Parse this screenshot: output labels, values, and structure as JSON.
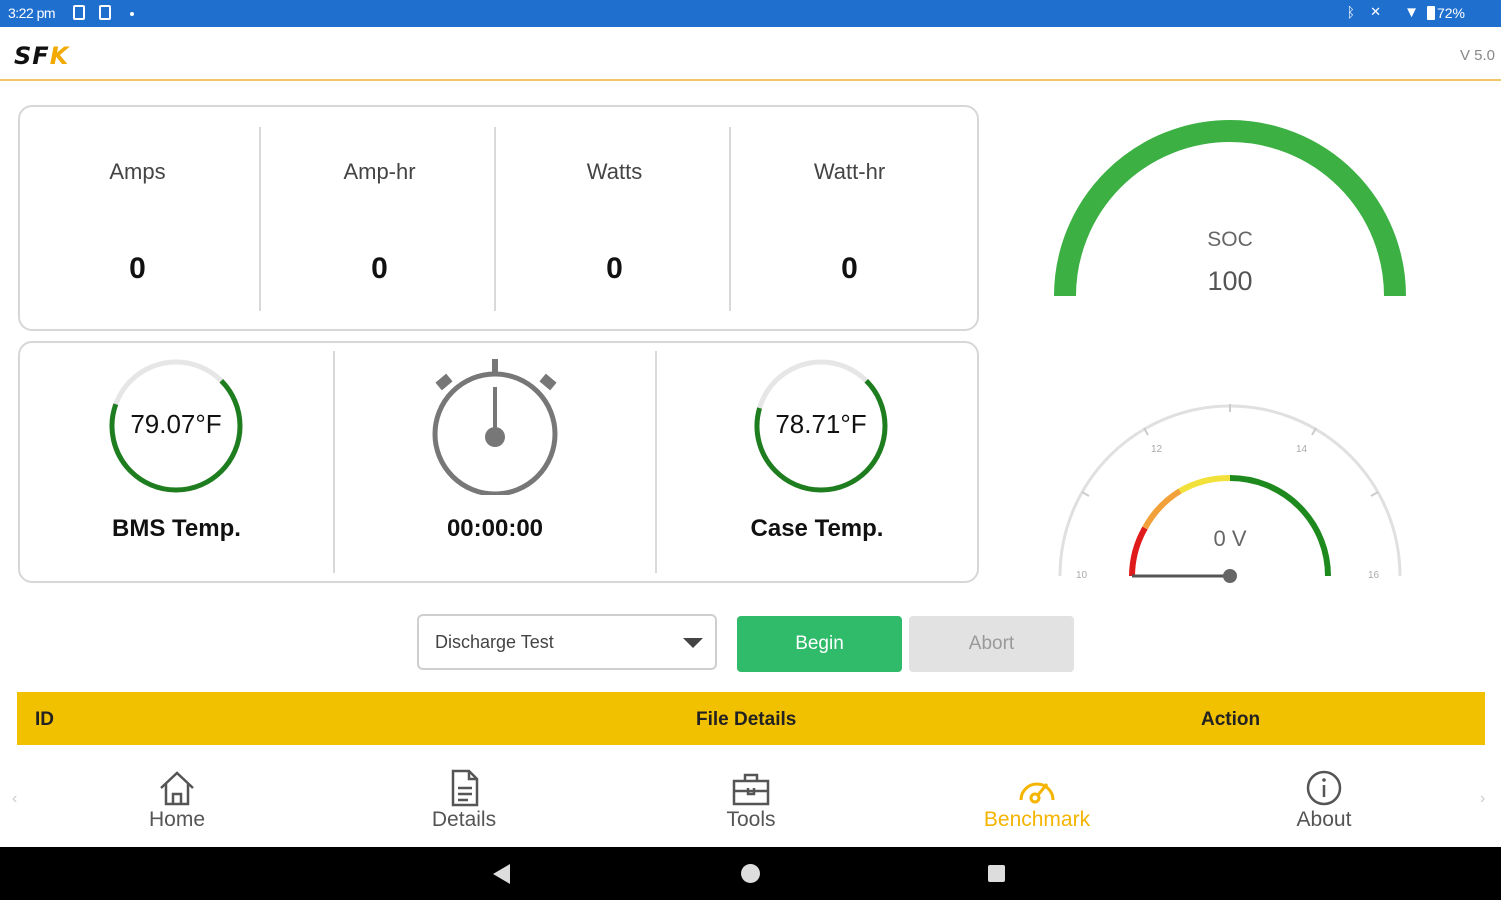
{
  "status_bar": {
    "time": "3:22 pm",
    "battery": "72%"
  },
  "app_bar": {
    "logo_main": "SF",
    "logo_accent": "K",
    "version": "V 5.0"
  },
  "stats": [
    {
      "label": "Amps",
      "value": "0"
    },
    {
      "label": "Amp-hr",
      "value": "0"
    },
    {
      "label": "Watts",
      "value": "0"
    },
    {
      "label": "Watt-hr",
      "value": "0"
    }
  ],
  "temps": {
    "bms": {
      "value": "79.07°F",
      "label": "BMS Temp.",
      "fill_fraction": 0.68
    },
    "timer": {
      "value": "00:00:00"
    },
    "case": {
      "value": "78.71°F",
      "label": "Case Temp.",
      "fill_fraction": 0.67
    }
  },
  "soc_gauge": {
    "label": "SOC",
    "value": "100",
    "fill_fraction": 1.0,
    "color": "#3cb043"
  },
  "voltage_gauge": {
    "label": "0 V",
    "ticks": [
      "10",
      "12",
      "14",
      "16"
    ],
    "value": 0,
    "colors": {
      "low": "#e01b1b",
      "mid": "#f2a13a",
      "warn": "#f2e13a",
      "ok": "#1e8a1e"
    }
  },
  "controls": {
    "test_select": "Discharge Test",
    "begin_label": "Begin",
    "abort_label": "Abort"
  },
  "table": {
    "headers": [
      "ID",
      "File Details",
      "Action"
    ]
  },
  "bottom_nav": [
    {
      "label": "Home",
      "icon": "home-icon",
      "active": false
    },
    {
      "label": "Details",
      "icon": "document-icon",
      "active": false
    },
    {
      "label": "Tools",
      "icon": "toolbox-icon",
      "active": false
    },
    {
      "label": "Benchmark",
      "icon": "speedometer-icon",
      "active": true
    },
    {
      "label": "About",
      "icon": "info-icon",
      "active": false
    }
  ],
  "colors": {
    "status_bar": "#1f6fcf",
    "accent_yellow": "#f1c100",
    "begin_green": "#2fbb6a",
    "ring_green": "#1e7d1e"
  }
}
